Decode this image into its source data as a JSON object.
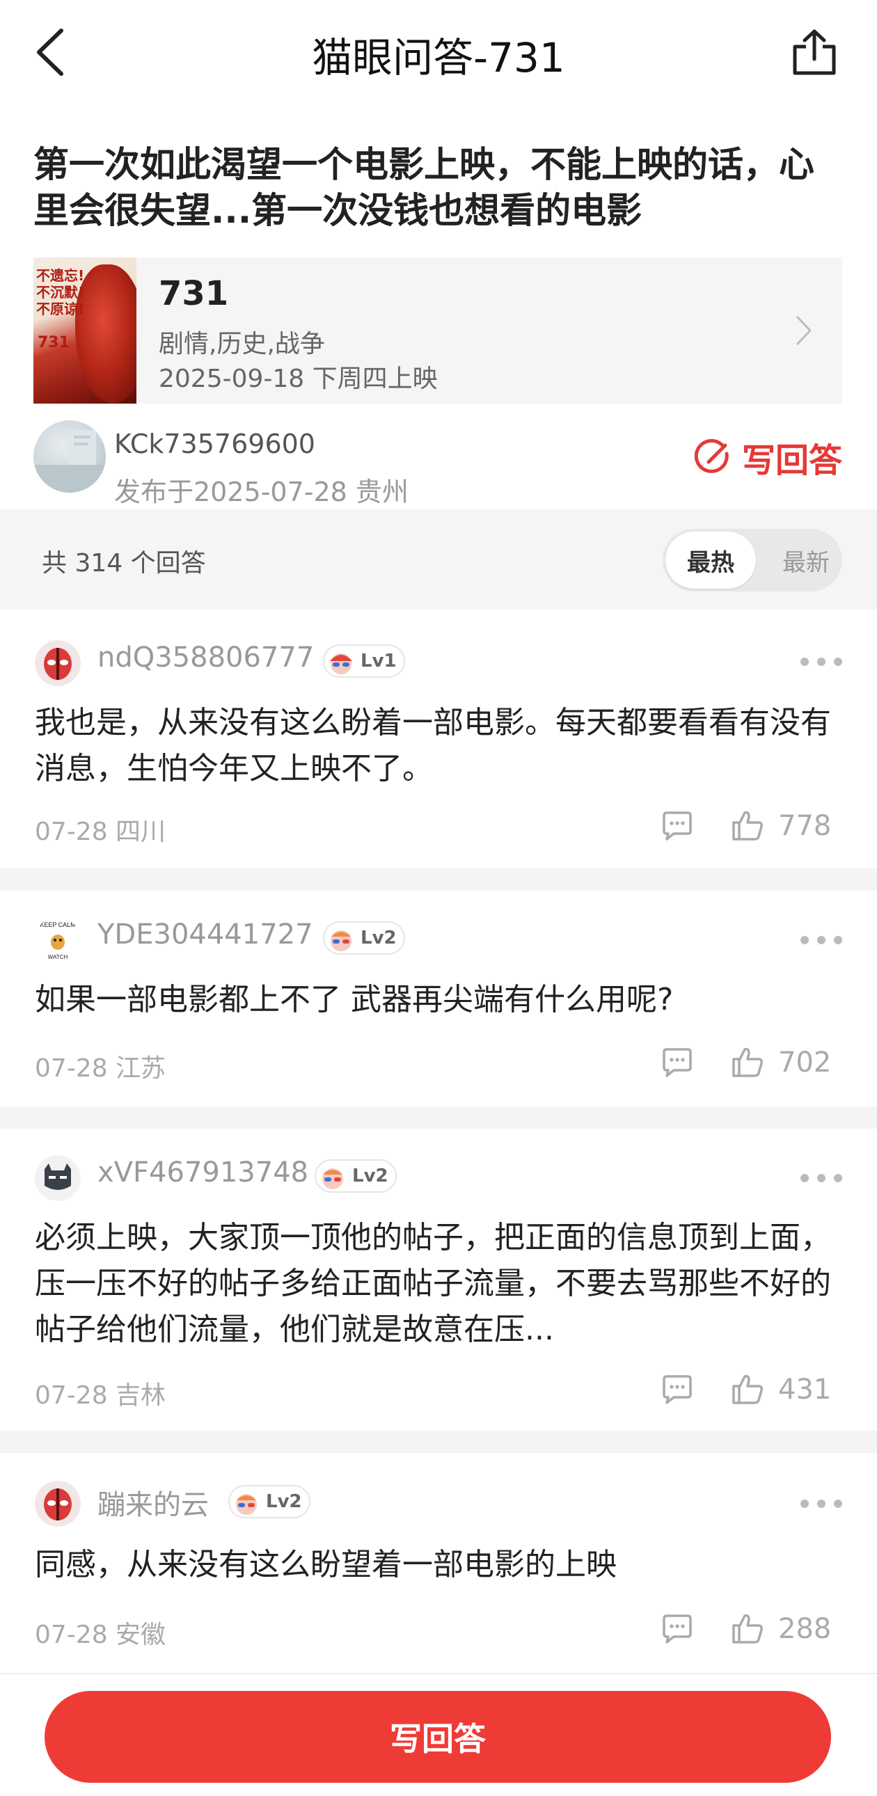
{
  "nav": {
    "title": "猫眼问答-731"
  },
  "question": {
    "title": "第一次如此渴望一个电影上映，不能上映的话，心里会很失望...第一次没钱也想看的电影"
  },
  "movie": {
    "poster_text": "不遗忘!\n不沉默!\n不原谅!",
    "poster_number": "731",
    "name": "731",
    "genre": "剧情,历史,战争",
    "release": "2025-09-18 下周四上映"
  },
  "author": {
    "name": "KCk735769600",
    "meta": "发布于2025-07-28  贵州",
    "write_answer_label": "写回答"
  },
  "answers_header": {
    "count_text": "共 314 个回答",
    "sort_hot": "最热",
    "sort_new": "最新"
  },
  "answers": [
    {
      "user": "ndQ358806777",
      "level": "Lv1",
      "text": "我也是，从来没有这么盼着一部电影。每天都要看看有没有消息，生怕今年又上映不了。",
      "date_loc": "07-28 四川",
      "likes": "778"
    },
    {
      "user": "YDE304441727",
      "level": "Lv2",
      "text": "如果一部电影都上不了 武器再尖端有什么用呢?",
      "date_loc": "07-28 江苏",
      "likes": "702"
    },
    {
      "user": "xVF467913748",
      "level": "Lv2",
      "text": "必须上映，大家顶一顶他的帖子，把正面的信息顶到上面，压一压不好的帖子多给正面帖子流量，不要去骂那些不好的帖子给他们流量，他们就是故意在压...",
      "date_loc": "07-28 吉林",
      "likes": "431"
    },
    {
      "user": "蹦来的云",
      "level": "Lv2",
      "text": "同感，从来没有这么盼望着一部电影的上映",
      "date_loc": "07-28 安徽",
      "likes": "288"
    }
  ],
  "bottom": {
    "write_answer_label": "写回答"
  },
  "colors": {
    "accent": "#ef3b36",
    "muted": "#aaaaaa"
  }
}
